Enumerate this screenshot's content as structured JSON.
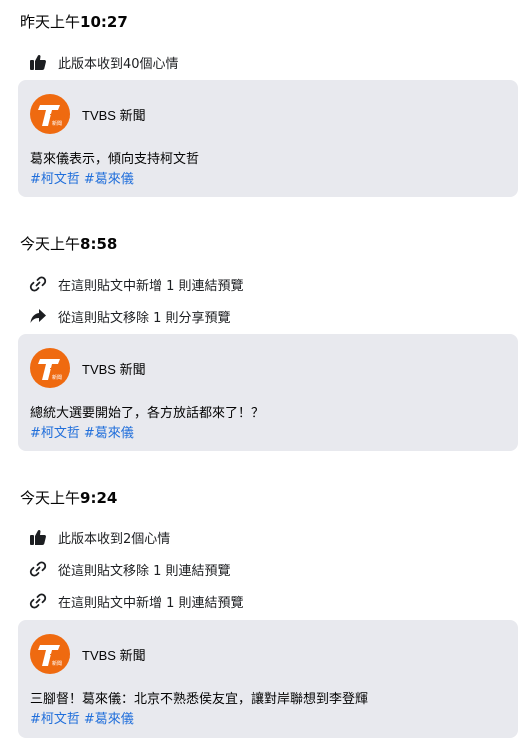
{
  "sections": [
    {
      "title_prefix": "昨天上午",
      "title_time": "10:27",
      "changes": [
        {
          "icon": "thumbs-up-icon",
          "text": "此版本收到40個心情"
        }
      ],
      "card": {
        "page_name": "TVBS 新聞",
        "text": "葛來儀表示，傾向支持柯文哲",
        "tags": [
          "#柯文哲",
          "#葛來儀"
        ]
      }
    },
    {
      "title_prefix": "今天上午",
      "title_time": "8:58",
      "changes": [
        {
          "icon": "link-icon",
          "text": "在這則貼文中新增 1 則連結預覽"
        },
        {
          "icon": "share-arrow-icon",
          "text": "從這則貼文移除 1 則分享預覽"
        }
      ],
      "card": {
        "page_name": "TVBS 新聞",
        "text": "總統大選要開始了，各方放話都來了！？",
        "tags": [
          "#柯文哲",
          "#葛來儀"
        ]
      }
    },
    {
      "title_prefix": "今天上午",
      "title_time": "9:24",
      "changes": [
        {
          "icon": "thumbs-up-icon",
          "text": "此版本收到2個心情"
        },
        {
          "icon": "link-icon",
          "text": "從這則貼文移除 1 則連結預覽"
        },
        {
          "icon": "link-icon",
          "text": "在這則貼文中新增 1 則連結預覽"
        }
      ],
      "card": {
        "page_name": "TVBS 新聞",
        "text": "三腳督！葛來儀：北京不熟悉侯友宜，讓對岸聯想到李登輝",
        "tags": [
          "#柯文哲",
          "#葛來儀"
        ]
      }
    }
  ],
  "logo": {
    "text": "TVBS",
    "subtext": "新聞",
    "color": "#ef6a10"
  },
  "colors": {
    "card_bg": "#e8e9ee",
    "hashtag": "#216fdb"
  }
}
